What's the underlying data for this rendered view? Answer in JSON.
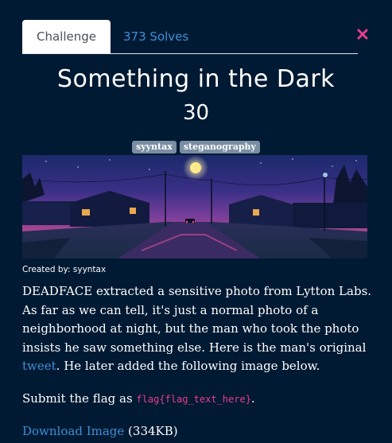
{
  "tabs": {
    "challenge_label": "Challenge",
    "solves_label": "373 Solves"
  },
  "challenge": {
    "title": "Something in the Dark",
    "value": "30",
    "tags": [
      "syyntax",
      "steganography"
    ],
    "created_by": "Created by: syyntax",
    "description_part1": "DEADFACE extracted a sensitive photo from Lytton Labs. As far as we can tell, it's just a normal photo of a neighborhood at night, but the man who took the photo insists he saw something else. Here is the man's original ",
    "description_link": "tweet",
    "description_part2": ". He later added the following image below.",
    "submit_prefix": "Submit the flag as ",
    "flag_format": "flag{flag_text_here}",
    "submit_suffix": ".",
    "download_link": "Download Image",
    "download_size": " (334KB)"
  },
  "icons": {
    "close": "close-icon"
  },
  "colors": {
    "background": "#001a33",
    "link": "#3d8fd6",
    "code": "#e83e8c",
    "close": "#e83e8c",
    "tag": "#7a8ea3"
  }
}
